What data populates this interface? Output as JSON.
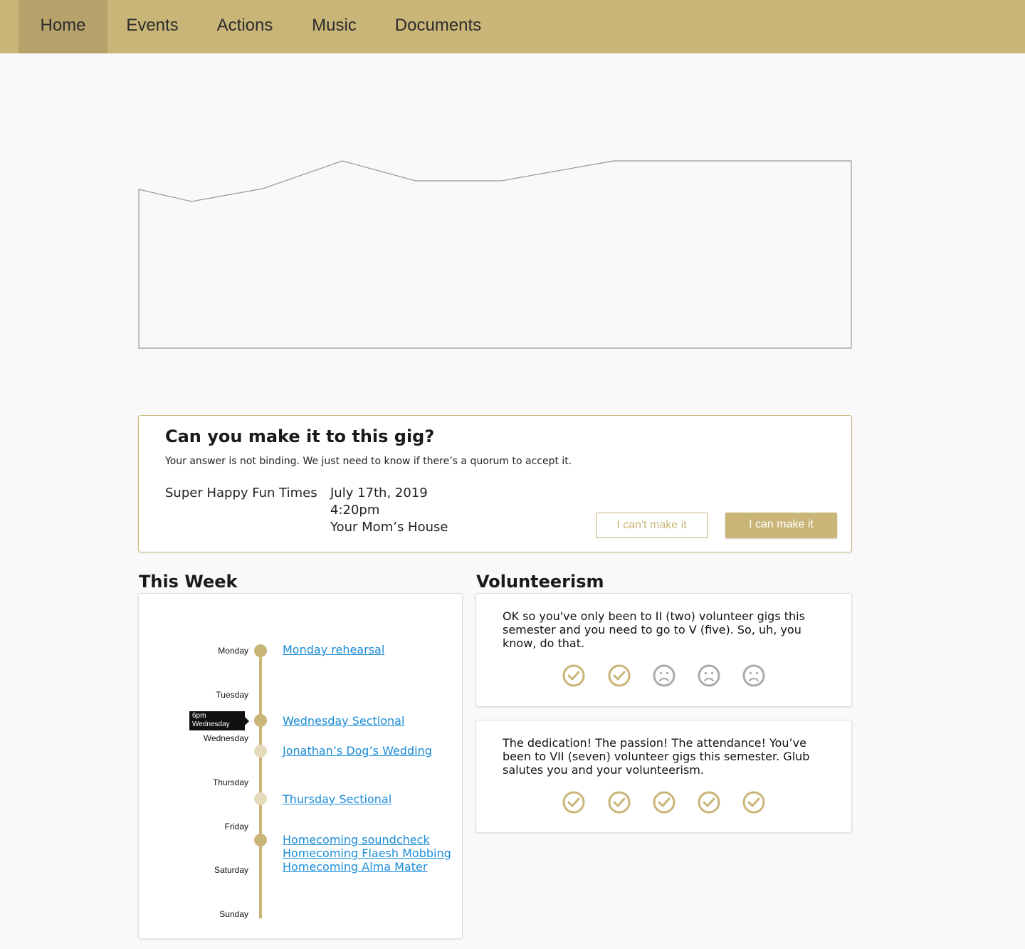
{
  "nav": {
    "items": [
      {
        "label": "Home",
        "active": true
      },
      {
        "label": "Events",
        "active": false
      },
      {
        "label": "Actions",
        "active": false
      },
      {
        "label": "Music",
        "active": false
      },
      {
        "label": "Documents",
        "active": false
      }
    ]
  },
  "colors": {
    "accent": "#c9b577",
    "accent_dark": "#b6a26a",
    "link": "#1a8cd8",
    "muted_icon": "#aaaaaa"
  },
  "gig": {
    "title": "Can you make it to this gig?",
    "subtitle": "Your answer is not binding. We just need to know if there’s a quorum to accept it.",
    "name": "Super Happy Fun Times",
    "date": "July 17th, 2019",
    "time": "4:20pm",
    "location": "Your Mom’s House",
    "cant_label": "I can't make it",
    "can_label": "I can make it"
  },
  "this_week": {
    "title": "This Week",
    "days": [
      "Monday",
      "Tuesday",
      "Wednesday",
      "Thursday",
      "Friday",
      "Saturday",
      "Sunday"
    ],
    "tooltip": {
      "time": "6pm",
      "day": "Wednesday"
    },
    "events": [
      "Monday rehearsal",
      "Wednesday Sectional",
      "Jonathan’s Dog’s Wedding",
      "Thursday Sectional",
      "Homecoming soundcheck",
      "Homecoming Flaesh Mobbing",
      "Homecoming Alma Mater"
    ]
  },
  "volunteerism": {
    "title": "Volunteerism",
    "cards": [
      {
        "text": "OK so you've only been to II (two) volunteer gigs this semester and you need to go to V (five). So, uh, you know, do that.",
        "icons": [
          "check-circle-icon",
          "check-circle-icon",
          "sad-face-icon",
          "sad-face-icon",
          "sad-face-icon"
        ]
      },
      {
        "text": "The dedication! The passion! The attendance! You’ve been to VII (seven) volunteer gigs this semester. Glub salutes you and your volunteerism.",
        "icons": [
          "check-circle-icon",
          "check-circle-icon",
          "check-circle-icon",
          "check-circle-icon",
          "check-circle-icon"
        ]
      }
    ]
  }
}
